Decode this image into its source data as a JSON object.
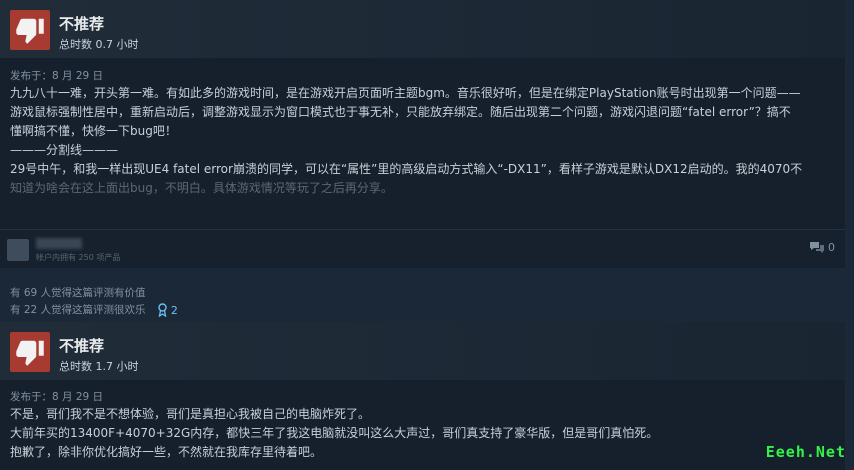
{
  "review1": {
    "recommendation": "不推荐",
    "hours": "总时数 0.7 小时",
    "posted": "发布于：8 月 29 日",
    "lines": [
      "九九八十一难，开头第一难。有如此多的游戏时间，是在游戏开启页面听主题bgm。音乐很好听，但是在绑定PlayStation账号时出现第一个问题——",
      "游戏鼠标强制性居中，重新启动后，调整游戏显示为窗口模式也于事无补，只能放弃绑定。随后出现第二个问题，游戏闪退问题“fatel error”？搞不",
      "懂啊搞不懂，快修一下bug吧！",
      "———分割线———",
      "29号中午，和我一样出现UE4 fatel error崩溃的同学，可以在“属性”里的高级启动方式输入“-DX11”，看样子游戏是默认DX12启动的。我的4070不",
      "知道为啥会在这上面出bug，不明白。具体游戏情况等玩了之后再分享。"
    ],
    "user_products": "帐户内拥有 250 项产品",
    "comment_count": "0"
  },
  "helpful": {
    "useful": "有 69 人觉得这篇评测有价值",
    "funny": "有 22 人觉得这篇评测很欢乐",
    "award_count": "2"
  },
  "review2": {
    "recommendation": "不推荐",
    "hours": "总时数 1.7 小时",
    "posted": "发布于：8 月 29 日",
    "lines": [
      "不是，哥们我不是不想体验，哥们是真担心我被自己的电脑炸死了。",
      "大前年买的13400F+4070+32G内存，都快三年了我这电脑就没叫这么大声过，哥们真支持了豪华版，但是哥们真怕死。",
      "抱歉了，除非你优化搞好一些，不然就在我库存里待着吧。"
    ]
  },
  "watermark": "Eeeh.Net",
  "colors": {
    "background": "#1b2838",
    "thumb_down": "#a83b31",
    "award": "#67c1f5",
    "watermark": "#34f04c"
  },
  "icons": [
    "thumbs-down-icon",
    "comment-icon",
    "award-icon"
  ]
}
